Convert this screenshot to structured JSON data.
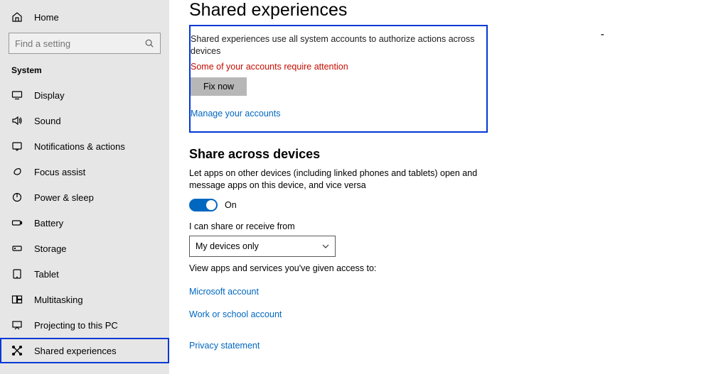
{
  "sidebar": {
    "home": "Home",
    "search_placeholder": "Find a setting",
    "section": "System",
    "items": [
      {
        "icon": "display",
        "label": "Display"
      },
      {
        "icon": "sound",
        "label": "Sound"
      },
      {
        "icon": "notifications",
        "label": "Notifications & actions"
      },
      {
        "icon": "focus",
        "label": "Focus assist"
      },
      {
        "icon": "power",
        "label": "Power & sleep"
      },
      {
        "icon": "battery",
        "label": "Battery"
      },
      {
        "icon": "storage",
        "label": "Storage"
      },
      {
        "icon": "tablet",
        "label": "Tablet"
      },
      {
        "icon": "multitask",
        "label": "Multitasking"
      },
      {
        "icon": "project",
        "label": "Projecting to this PC"
      },
      {
        "icon": "shared",
        "label": "Shared experiences"
      }
    ]
  },
  "main": {
    "title": "Shared experiences",
    "desc": "Shared experiences use all system accounts to authorize actions across devices",
    "warn": "Some of your accounts require attention",
    "fix_label": "Fix now",
    "manage_link": "Manage your accounts",
    "share_heading": "Share across devices",
    "share_desc": "Let apps on other devices (including linked phones and tablets) open and message apps on this device, and vice versa",
    "toggle_state": "On",
    "receive_label": "I can share or receive from",
    "receive_value": "My devices only",
    "access_label": "View apps and services you've given access to:",
    "ms_account": "Microsoft account",
    "work_account": "Work or school account",
    "privacy": "Privacy statement"
  }
}
